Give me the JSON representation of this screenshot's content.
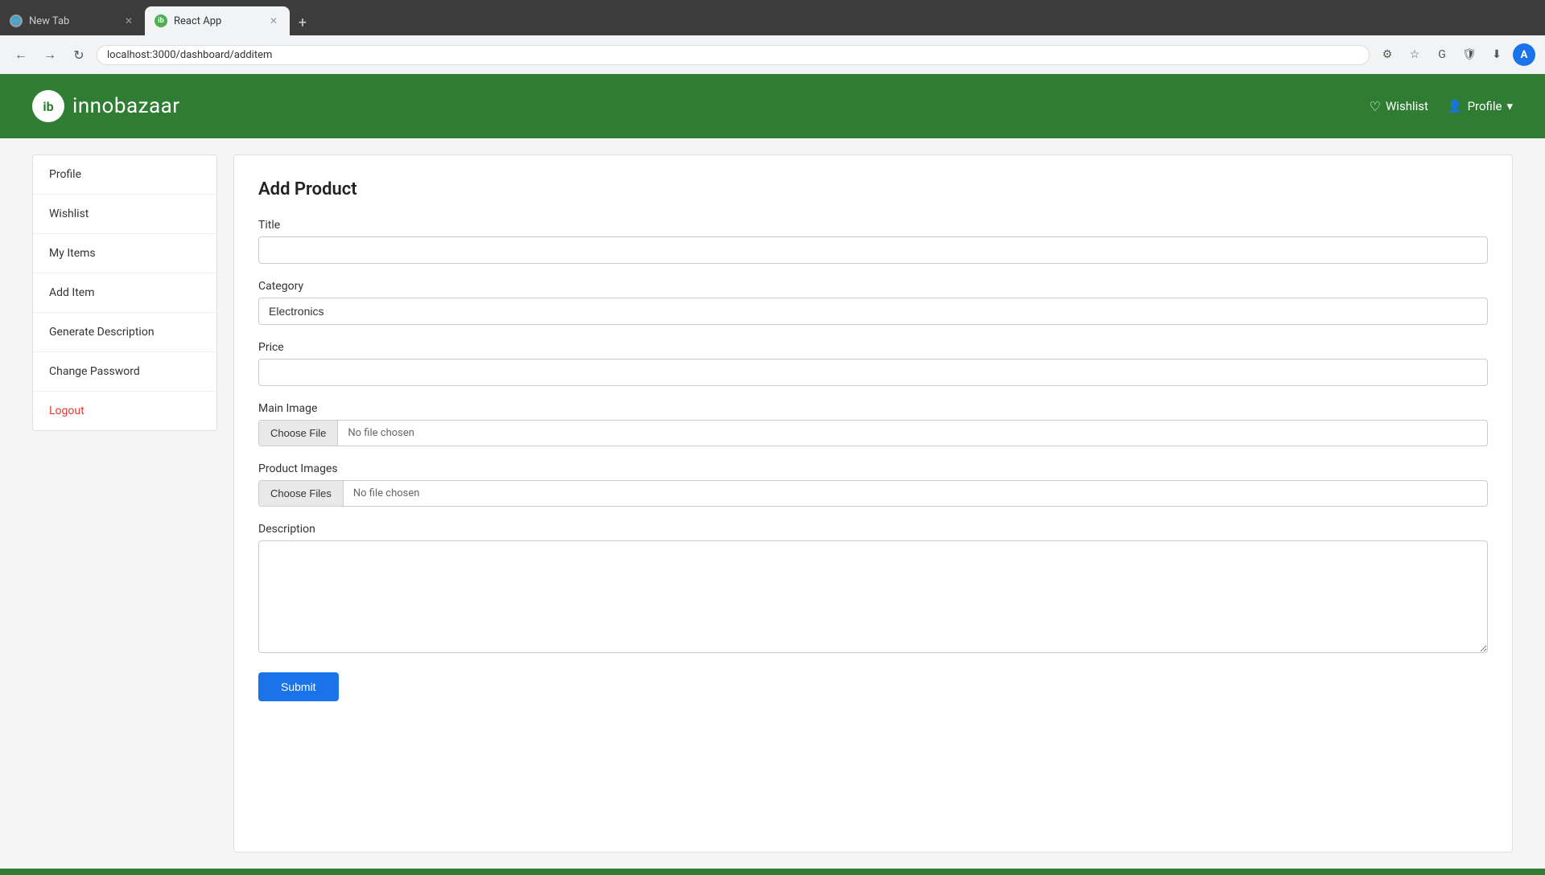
{
  "browser": {
    "tabs": [
      {
        "id": "new-tab",
        "label": "New Tab",
        "active": false,
        "favicon": "🌐"
      },
      {
        "id": "react-app",
        "label": "React App",
        "active": true,
        "favicon": "ib"
      }
    ],
    "add_tab_label": "+",
    "address": "localhost:3000/dashboard/additem",
    "back_icon": "←",
    "forward_icon": "→",
    "refresh_icon": "↻",
    "profile_avatar": "A"
  },
  "header": {
    "logo_text": "ib",
    "brand_name": "innobazaar",
    "wishlist_label": "Wishlist",
    "profile_label": "Profile",
    "profile_chevron": "▾"
  },
  "sidebar": {
    "items": [
      {
        "id": "profile",
        "label": "Profile",
        "logout": false
      },
      {
        "id": "wishlist",
        "label": "Wishlist",
        "logout": false
      },
      {
        "id": "my-items",
        "label": "My Items",
        "logout": false
      },
      {
        "id": "add-item",
        "label": "Add Item",
        "logout": false
      },
      {
        "id": "generate-description",
        "label": "Generate Description",
        "logout": false
      },
      {
        "id": "change-password",
        "label": "Change Password",
        "logout": false
      },
      {
        "id": "logout",
        "label": "Logout",
        "logout": true
      }
    ]
  },
  "form": {
    "title": "Add Product",
    "fields": {
      "title_label": "Title",
      "title_placeholder": "",
      "category_label": "Category",
      "category_value": "Electronics",
      "price_label": "Price",
      "price_placeholder": "",
      "main_image_label": "Main Image",
      "choose_file_btn": "Choose File",
      "no_file_chosen": "No file chosen",
      "product_images_label": "Product Images",
      "choose_files_btn": "Choose Files",
      "no_files_chosen": "No file chosen",
      "description_label": "Description",
      "description_placeholder": ""
    },
    "submit_label": "Submit"
  },
  "colors": {
    "brand_green": "#2e7d32",
    "accent_blue": "#1a73e8",
    "logout_red": "#e53935"
  }
}
